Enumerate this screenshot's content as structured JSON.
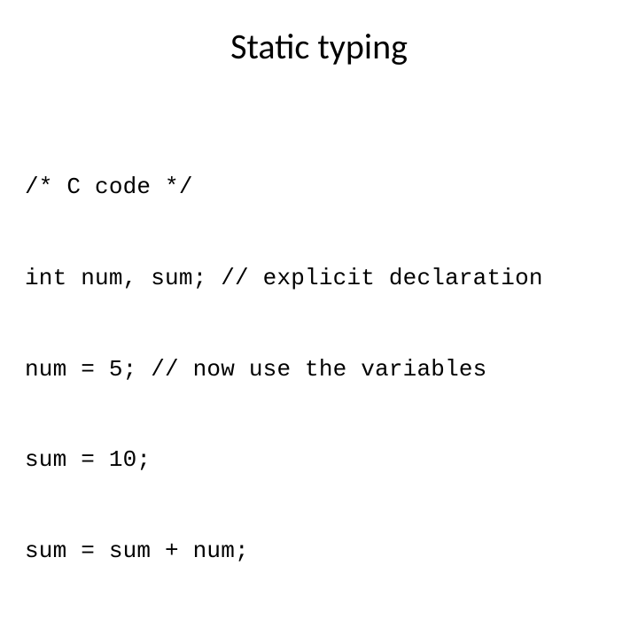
{
  "slide": {
    "title": "Static typing",
    "code": {
      "line1": "/* C code */",
      "line2": "int num, sum; // explicit declaration",
      "line3": "num = 5; // now use the variables",
      "line4": "sum = 10;",
      "line5": "sum = sum + num;"
    }
  }
}
